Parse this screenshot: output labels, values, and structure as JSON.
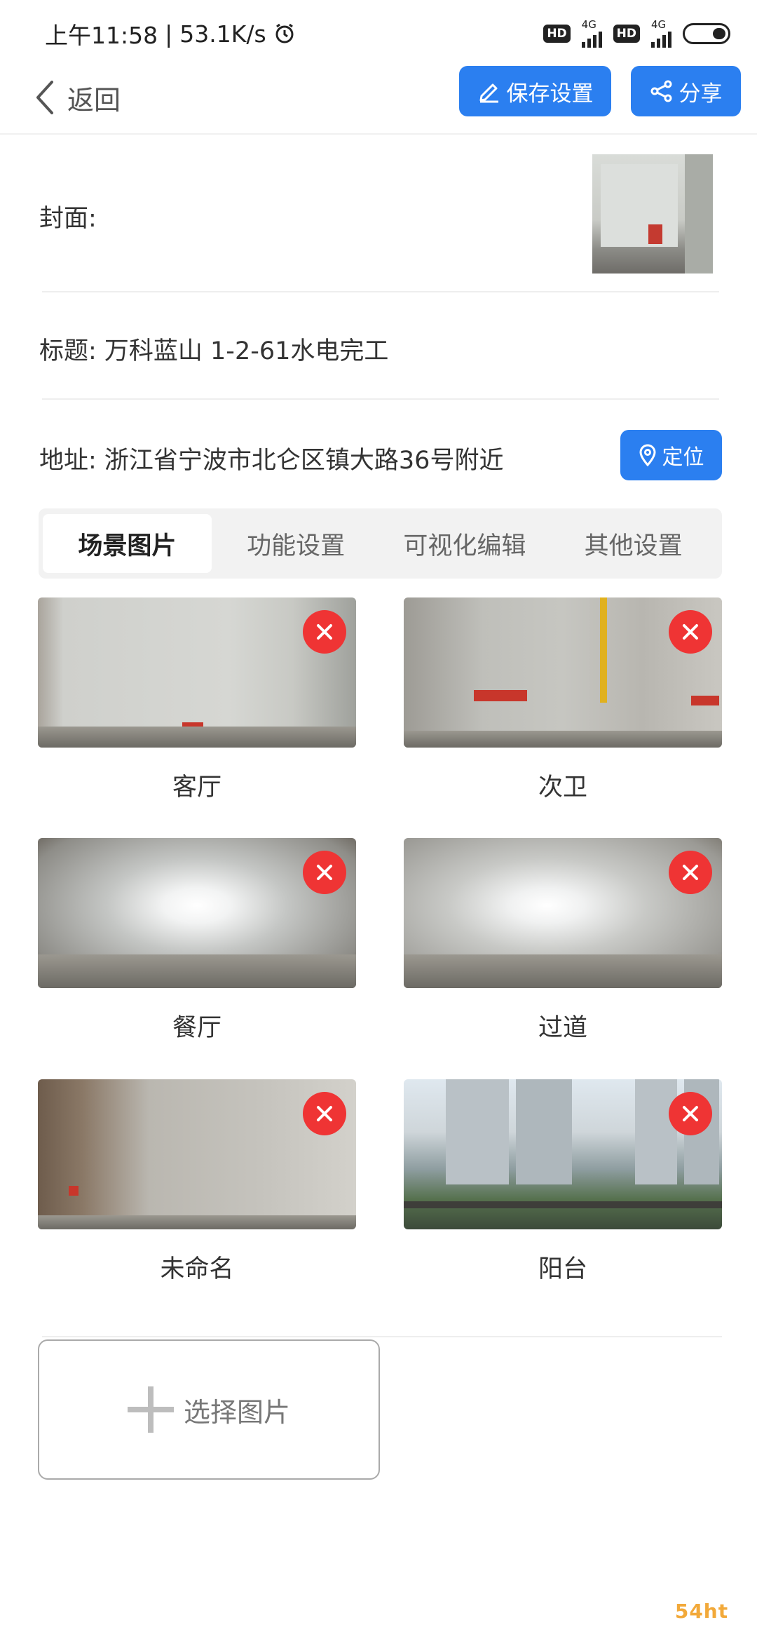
{
  "status_bar": {
    "time": "上午11:58",
    "net_speed": "53.1K/s",
    "sim1_hd": "HD",
    "sim1_net": "4G",
    "sim2_hd": "HD",
    "sim2_net": "4G"
  },
  "header": {
    "back_label": "返回",
    "save_label": "保存设置",
    "share_label": "分享"
  },
  "form": {
    "cover_label": "封面:",
    "title_text": "标题: 万科蓝山 1-2-61水电完工",
    "address_text": "地址: 浙江省宁波市北仑区镇大路36号附近",
    "locate_label": "定位"
  },
  "tabs": [
    {
      "label": "场景图片",
      "active": true
    },
    {
      "label": "功能设置",
      "active": false
    },
    {
      "label": "可视化编辑",
      "active": false
    },
    {
      "label": "其他设置",
      "active": false
    }
  ],
  "scenes": [
    {
      "label": "客厅"
    },
    {
      "label": "次卫"
    },
    {
      "label": "餐厅"
    },
    {
      "label": "过道"
    },
    {
      "label": "未命名"
    },
    {
      "label": "阳台"
    }
  ],
  "select_image_label": "选择图片",
  "watermark_text": "54ht",
  "colors": {
    "accent": "#2b7ff0",
    "delete": "#ef3434"
  }
}
